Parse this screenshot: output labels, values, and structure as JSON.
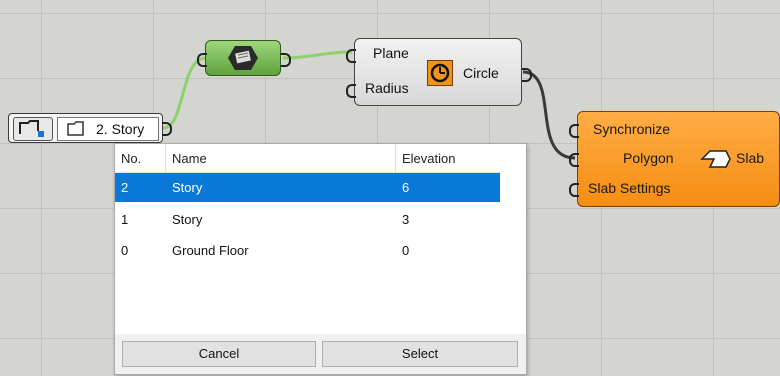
{
  "canvas": {
    "story_param": {
      "label": "2. Story"
    },
    "circle_component": {
      "inputs": [
        "Plane",
        "Radius"
      ],
      "output": "Circle"
    },
    "slab_component": {
      "inputs": [
        "Synchronize",
        "Polygon",
        "Slab Settings"
      ],
      "output": "Slab"
    }
  },
  "dialog": {
    "columns": {
      "no": "No.",
      "name": "Name",
      "elevation": "Elevation"
    },
    "rows": [
      {
        "no": "2",
        "name": "Story",
        "elevation": "6",
        "selected": true
      },
      {
        "no": "1",
        "name": "Story",
        "elevation": "3",
        "selected": false
      },
      {
        "no": "0",
        "name": "Ground Floor",
        "elevation": "0",
        "selected": false
      }
    ],
    "buttons": {
      "cancel": "Cancel",
      "select": "Select"
    }
  },
  "colors": {
    "canvas_bg": "#d4d4d0",
    "selection": "#0a78d7",
    "slab_orange": "#f58d12",
    "green_component": "#7cc05a",
    "wire_green": "#8cd26a",
    "wire_dark": "#3a3a3a"
  },
  "icons": [
    "story-param-icon",
    "story-small-icon",
    "level-capture-icon",
    "circle-clock-icon",
    "slab-arrow-icon"
  ]
}
